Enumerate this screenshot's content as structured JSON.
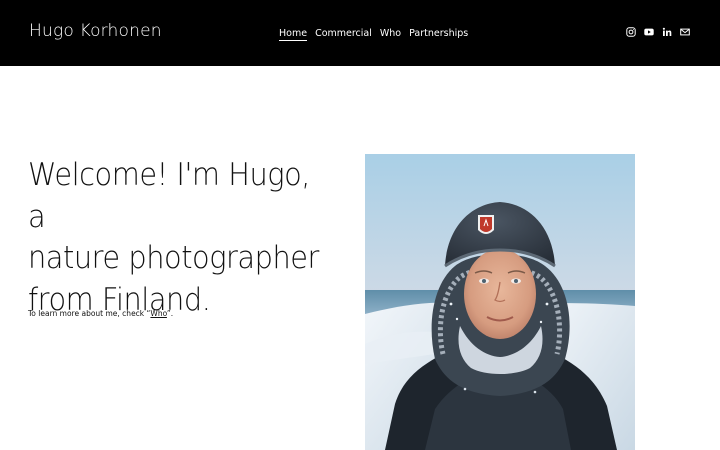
{
  "site": {
    "title": "Hugo Korhonen"
  },
  "nav": {
    "items": [
      {
        "label": "Home",
        "active": true
      },
      {
        "label": "Commercial",
        "active": false
      },
      {
        "label": "Who",
        "active": false
      },
      {
        "label": "Partnerships",
        "active": false
      }
    ]
  },
  "social": {
    "icons": [
      "instagram-icon",
      "youtube-icon",
      "linkedin-icon",
      "email-icon"
    ]
  },
  "hero": {
    "line1": "Welcome! I'm Hugo, a",
    "line2": "nature photographer",
    "line3": "from Finland.",
    "intro_prefix": "To learn more about me, check “",
    "intro_link": "Who",
    "intro_suffix": "”."
  },
  "colors": {
    "header_bg": "#000000",
    "header_text": "#ffffff",
    "page_bg": "#ffffff",
    "text": "#111111"
  }
}
